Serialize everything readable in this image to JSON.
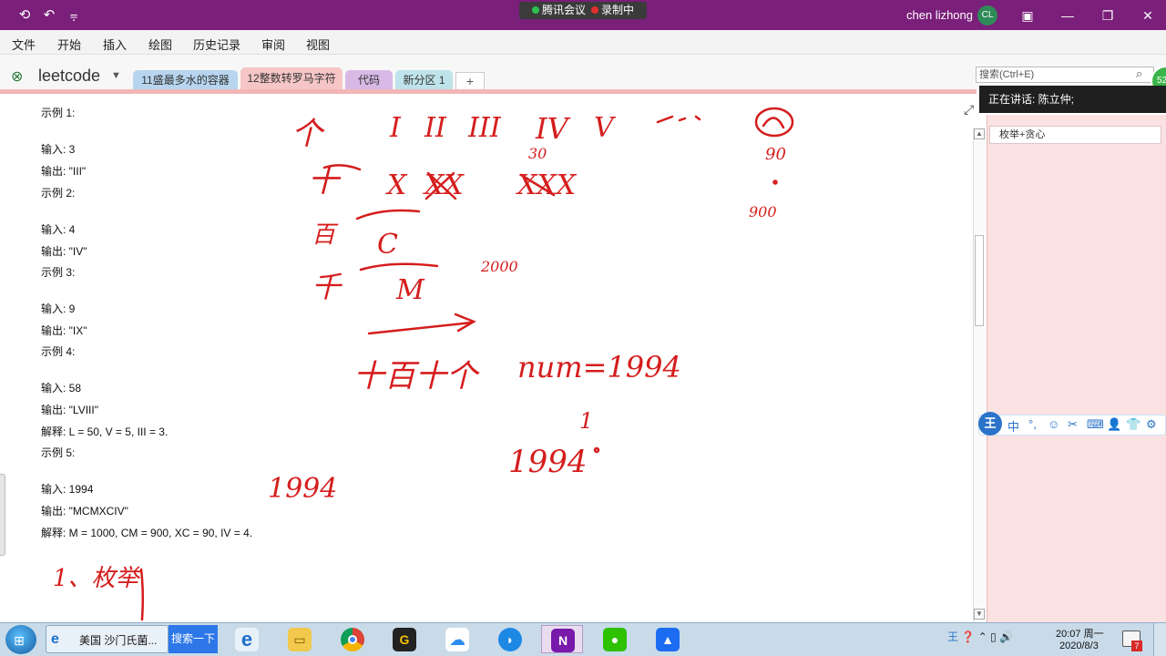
{
  "window": {
    "meeting_label": "腾讯会议",
    "recording_label": "录制中",
    "user_name": "chen lizhong",
    "avatar_initials": "CL"
  },
  "menu": [
    "文件",
    "开始",
    "插入",
    "绘图",
    "历史记录",
    "审阅",
    "视图"
  ],
  "notebook": {
    "name": "leetcode",
    "tabs": [
      {
        "label": "11盛最多水的容器",
        "color": "#b7d5ee"
      },
      {
        "label": "12整数转罗马字符",
        "color": "#f6c6c6"
      },
      {
        "label": "代码",
        "color": "#d8b9e6"
      },
      {
        "label": "新分区 1",
        "color": "#bfe3ea"
      }
    ],
    "add_tab": "+"
  },
  "search": {
    "placeholder": "搜索(Ctrl+E)"
  },
  "speaking": "正在讲话: 陈立仲;",
  "badge_count": "52",
  "page_list": [
    "枚举+贪心"
  ],
  "content_lines": [
    "示例 1:",
    "输入: 3",
    "输出: \"III\"",
    "示例 2:",
    "输入: 4",
    "输出: \"IV\"",
    "示例 3:",
    "输入: 9",
    "输出: \"IX\"",
    "示例 4:",
    "输入: 58",
    "输出: \"LVIII\"",
    "解释: L = 50, V = 5, III = 3.",
    "示例 5:",
    "输入: 1994",
    "输出: \"MCMXCIV\"",
    "解释: M = 1000, CM = 900, XC = 90, IV = 4."
  ],
  "ink": {
    "color": "#d51d1d",
    "notes": [
      "个",
      "十",
      "百",
      "千",
      "I",
      "II",
      "III",
      "IV",
      "V",
      "X",
      "XX",
      "XXX",
      "C",
      "M",
      "30",
      "90",
      "900",
      "2000",
      "十百十个",
      "num=1994",
      "1",
      "1994",
      "1994",
      "1、枚举"
    ]
  },
  "taskbar": {
    "ie_label": "美国 沙门氏菌...",
    "search_button": "搜索一下",
    "time": "20:07 周一",
    "date": "2020/8/3",
    "notif_count": "7"
  }
}
